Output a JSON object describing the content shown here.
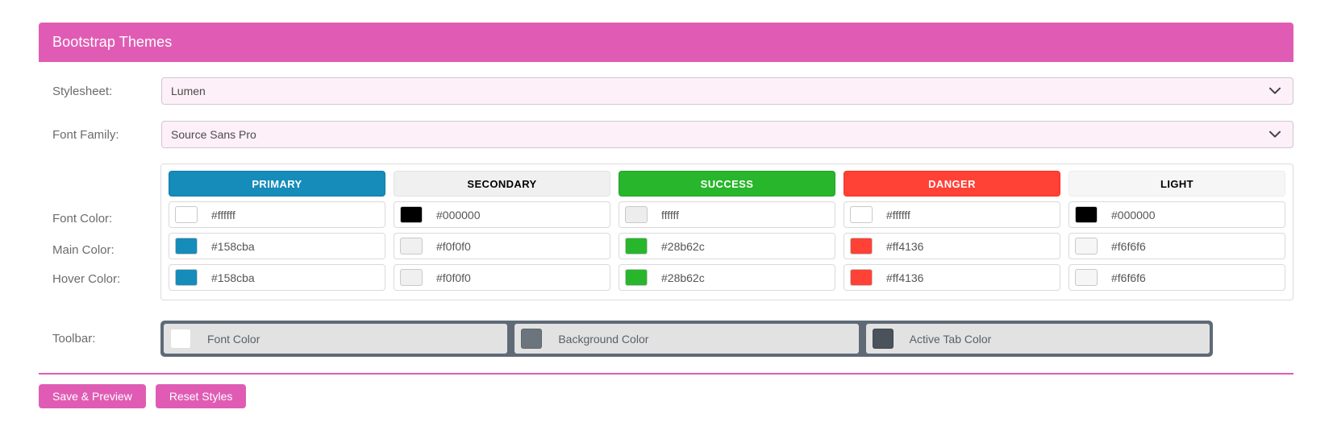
{
  "header": {
    "title": "Bootstrap Themes"
  },
  "form": {
    "stylesheet": {
      "label": "Stylesheet:",
      "value": "Lumen"
    },
    "font_family": {
      "label": "Font Family:",
      "value": "Source Sans Pro"
    }
  },
  "grid": {
    "row_labels": {
      "font_color": "Font Color:",
      "main_color": "Main Color:",
      "hover_color": "Hover Color:"
    },
    "columns": [
      {
        "key": "primary",
        "button_label": "PRIMARY",
        "button_bg": "#158cba",
        "button_fg": "#ffffff",
        "font_color": {
          "value": "#ffffff",
          "swatch": "#ffffff"
        },
        "main_color": {
          "value": "#158cba",
          "swatch": "#158cba"
        },
        "hover_color": {
          "value": "#158cba",
          "swatch": "#158cba"
        }
      },
      {
        "key": "secondary",
        "button_label": "SECONDARY",
        "button_bg": "#f0f0f0",
        "button_fg": "#000000",
        "font_color": {
          "value": "#000000",
          "swatch": "#000000"
        },
        "main_color": {
          "value": "#f0f0f0",
          "swatch": "#f0f0f0"
        },
        "hover_color": {
          "value": "#f0f0f0",
          "swatch": "#f0f0f0"
        }
      },
      {
        "key": "success",
        "button_label": "SUCCESS",
        "button_bg": "#28b62c",
        "button_fg": "#ffffff",
        "font_color": {
          "value": "ffffff",
          "swatch": "#ededed"
        },
        "main_color": {
          "value": "#28b62c",
          "swatch": "#28b62c"
        },
        "hover_color": {
          "value": "#28b62c",
          "swatch": "#28b62c"
        }
      },
      {
        "key": "danger",
        "button_label": "DANGER",
        "button_bg": "#ff4136",
        "button_fg": "#ffffff",
        "font_color": {
          "value": "#ffffff",
          "swatch": "#ffffff"
        },
        "main_color": {
          "value": "#ff4136",
          "swatch": "#ff4136"
        },
        "hover_color": {
          "value": "#ff4136",
          "swatch": "#ff4136"
        }
      },
      {
        "key": "light",
        "button_label": "LIGHT",
        "button_bg": "#f6f6f6",
        "button_fg": "#000000",
        "font_color": {
          "value": "#000000",
          "swatch": "#000000"
        },
        "main_color": {
          "value": "#f6f6f6",
          "swatch": "#f6f6f6"
        },
        "hover_color": {
          "value": "#f6f6f6",
          "swatch": "#f6f6f6"
        }
      }
    ]
  },
  "toolbar": {
    "label": "Toolbar:",
    "container_color": "#5f6a76",
    "items": [
      {
        "text": "Font Color",
        "swatch": "#ffffff"
      },
      {
        "text": "Background Color",
        "swatch": "#6c757d"
      },
      {
        "text": "Active Tab Color",
        "swatch": "#4a525c"
      }
    ]
  },
  "footer": {
    "accent_color": "#e05cb4",
    "save_label": "Save & Preview",
    "reset_label": "Reset Styles"
  }
}
